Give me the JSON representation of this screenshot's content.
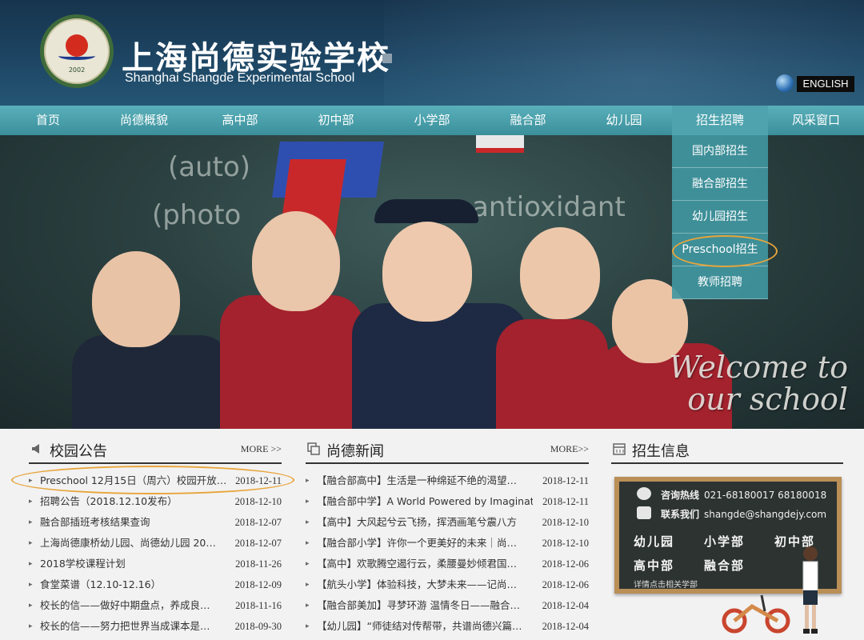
{
  "header": {
    "school_name_cn": "上海尚德实验学校",
    "school_name_en": "Shanghai Shangde Experimental School",
    "logo_year": "2002",
    "english_label": "ENGLISH"
  },
  "nav": {
    "items": [
      {
        "label": "首页"
      },
      {
        "label": "尚德概貌"
      },
      {
        "label": "高中部"
      },
      {
        "label": "初中部"
      },
      {
        "label": "小学部"
      },
      {
        "label": "融合部"
      },
      {
        "label": "幼儿园"
      },
      {
        "label": "招生招聘"
      },
      {
        "label": "风采窗口"
      }
    ],
    "dropdown": [
      {
        "label": "国内部招生"
      },
      {
        "label": "融合部招生"
      },
      {
        "label": "幼儿园招生"
      },
      {
        "label": "Preschool招生"
      },
      {
        "label": "教师招聘"
      }
    ]
  },
  "banner": {
    "welcome_line1": "Welcome to",
    "welcome_line2": "our school",
    "chalk1": "(auto)",
    "chalk2": "(photo",
    "chalk3": "antioxidant"
  },
  "announcements": {
    "title": "校园公告",
    "more": "MORE >>",
    "items": [
      {
        "title": "Preschool 12月15日（周六）校园开放…",
        "date": "2018-12-11"
      },
      {
        "title": "招聘公告（2018.12.10发布）",
        "date": "2018-12-10"
      },
      {
        "title": "融合部插班考核结果查询",
        "date": "2018-12-07"
      },
      {
        "title": "上海尚德康桥幼儿园、尚德幼儿园 20…",
        "date": "2018-12-07"
      },
      {
        "title": "2018学校课程计划",
        "date": "2018-11-26"
      },
      {
        "title": "食堂菜谱（12.10-12.16）",
        "date": "2018-12-09"
      },
      {
        "title": "校长的信——做好中期盘点，养成良…",
        "date": "2018-11-16"
      },
      {
        "title": "校长的信——努力把世界当成课本是…",
        "date": "2018-09-30"
      }
    ]
  },
  "news": {
    "title": "尚德新闻",
    "more": "MORE>>",
    "items": [
      {
        "title": "【融合部高中】生活是一种绵延不绝的渴望…",
        "date": "2018-12-11"
      },
      {
        "title": "【融合部中学】A World Powered by Imaginati…",
        "date": "2018-12-11"
      },
      {
        "title": "【高中】大风起兮云飞扬，挥洒画笔兮震八方",
        "date": "2018-12-10"
      },
      {
        "title": "【融合部小学】许你一个更美好的未来｜尚…",
        "date": "2018-12-10"
      },
      {
        "title": "【高中】欢歌腾空遏行云，柔腰曼妙倾君国…",
        "date": "2018-12-06"
      },
      {
        "title": "【航头小学】体验科技，大梦未来——记尚…",
        "date": "2018-12-06"
      },
      {
        "title": "【融合部美加】寻梦环游 温情冬日——融合…",
        "date": "2018-12-04"
      },
      {
        "title": "【幼儿园】“师徒结对传帮带，共谱尚德兴篇…",
        "date": "2018-12-04"
      }
    ]
  },
  "admissions": {
    "title": "招生信息",
    "hotline_label": "咨询热线",
    "hotline_value": "021-68180017 68180018",
    "contact_label": "联系我们",
    "contact_value": "shangde@shangdejy.com",
    "links": [
      "幼儿园",
      "小学部",
      "初中部",
      "高中部",
      "融合部"
    ],
    "note": "详情点击相关学部"
  },
  "colors": {
    "header_bg": "#1d4563",
    "nav_bg": "#3a8f9b",
    "highlight_ring": "#e8a53b"
  }
}
